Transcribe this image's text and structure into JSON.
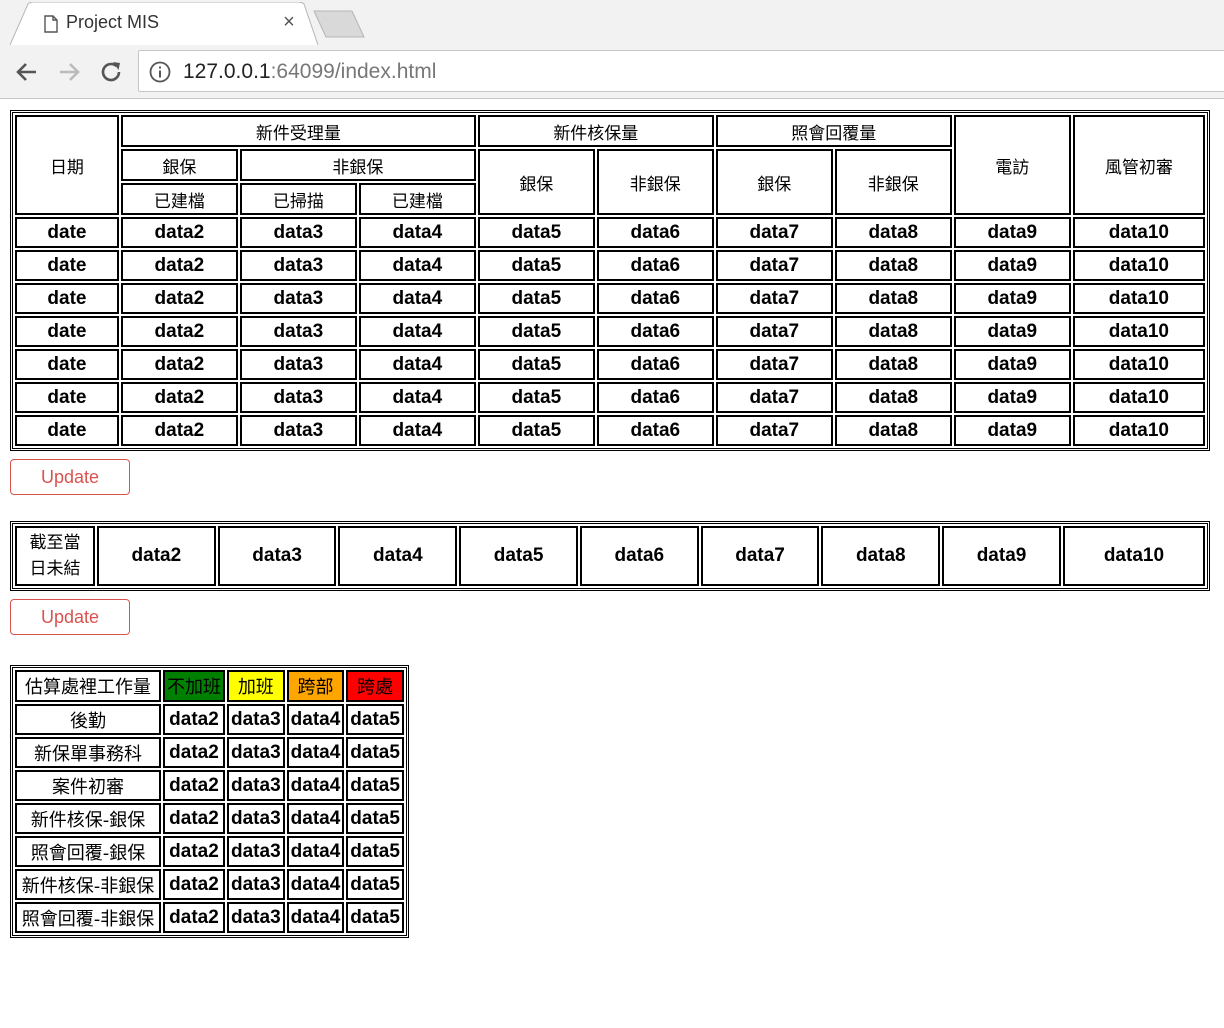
{
  "browser": {
    "tab_title": "Project MIS",
    "url_host": "127.0.0.1",
    "url_rest": ":64099/index.html"
  },
  "main_table": {
    "headers": {
      "date": "日期",
      "new_cases_received": "新件受理量",
      "bank": "銀保",
      "non_bank": "非銀保",
      "filed": "已建檔",
      "scanned": "已掃描",
      "filed2": "已建檔",
      "new_cases_underwritten": "新件核保量",
      "uw_bank": "銀保",
      "uw_non_bank": "非銀保",
      "inquiry_reply": "照會回覆量",
      "iq_bank": "銀保",
      "iq_non_bank": "非銀保",
      "phone_interview": "電訪",
      "risk_initial_review": "風管初審"
    },
    "rows": [
      [
        "date",
        "data2",
        "data3",
        "data4",
        "data5",
        "data6",
        "data7",
        "data8",
        "data9",
        "data10"
      ],
      [
        "date",
        "data2",
        "data3",
        "data4",
        "data5",
        "data6",
        "data7",
        "data8",
        "data9",
        "data10"
      ],
      [
        "date",
        "data2",
        "data3",
        "data4",
        "data5",
        "data6",
        "data7",
        "data8",
        "data9",
        "data10"
      ],
      [
        "date",
        "data2",
        "data3",
        "data4",
        "data5",
        "data6",
        "data7",
        "data8",
        "data9",
        "data10"
      ],
      [
        "date",
        "data2",
        "data3",
        "data4",
        "data5",
        "data6",
        "data7",
        "data8",
        "data9",
        "data10"
      ],
      [
        "date",
        "data2",
        "data3",
        "data4",
        "data5",
        "data6",
        "data7",
        "data8",
        "data9",
        "data10"
      ],
      [
        "date",
        "data2",
        "data3",
        "data4",
        "data5",
        "data6",
        "data7",
        "data8",
        "data9",
        "data10"
      ]
    ],
    "update_label": "Update"
  },
  "pending_table": {
    "label_line1": "截至當",
    "label_line2": "日未結",
    "values": [
      "data2",
      "data3",
      "data4",
      "data5",
      "data6",
      "data7",
      "data8",
      "data9",
      "data10"
    ],
    "update_label": "Update"
  },
  "workload_table": {
    "header_label": "估算處裡工作量",
    "levels": [
      {
        "label": "不加班",
        "color": "#008000"
      },
      {
        "label": "加班",
        "color": "#ffff00"
      },
      {
        "label": "跨部",
        "color": "#ffa500"
      },
      {
        "label": "跨處",
        "color": "#ff0000"
      }
    ],
    "rows": [
      {
        "label": "後勤",
        "values": [
          "data2",
          "data3",
          "data4",
          "data5"
        ]
      },
      {
        "label": "新保單事務科",
        "values": [
          "data2",
          "data3",
          "data4",
          "data5"
        ]
      },
      {
        "label": "案件初審",
        "values": [
          "data2",
          "data3",
          "data4",
          "data5"
        ]
      },
      {
        "label": "新件核保-銀保",
        "values": [
          "data2",
          "data3",
          "data4",
          "data5"
        ]
      },
      {
        "label": "照會回覆-銀保",
        "values": [
          "data2",
          "data3",
          "data4",
          "data5"
        ]
      },
      {
        "label": "新件核保-非銀保",
        "values": [
          "data2",
          "data3",
          "data4",
          "data5"
        ]
      },
      {
        "label": "照會回覆-非銀保",
        "values": [
          "data2",
          "data3",
          "data4",
          "data5"
        ]
      }
    ]
  }
}
